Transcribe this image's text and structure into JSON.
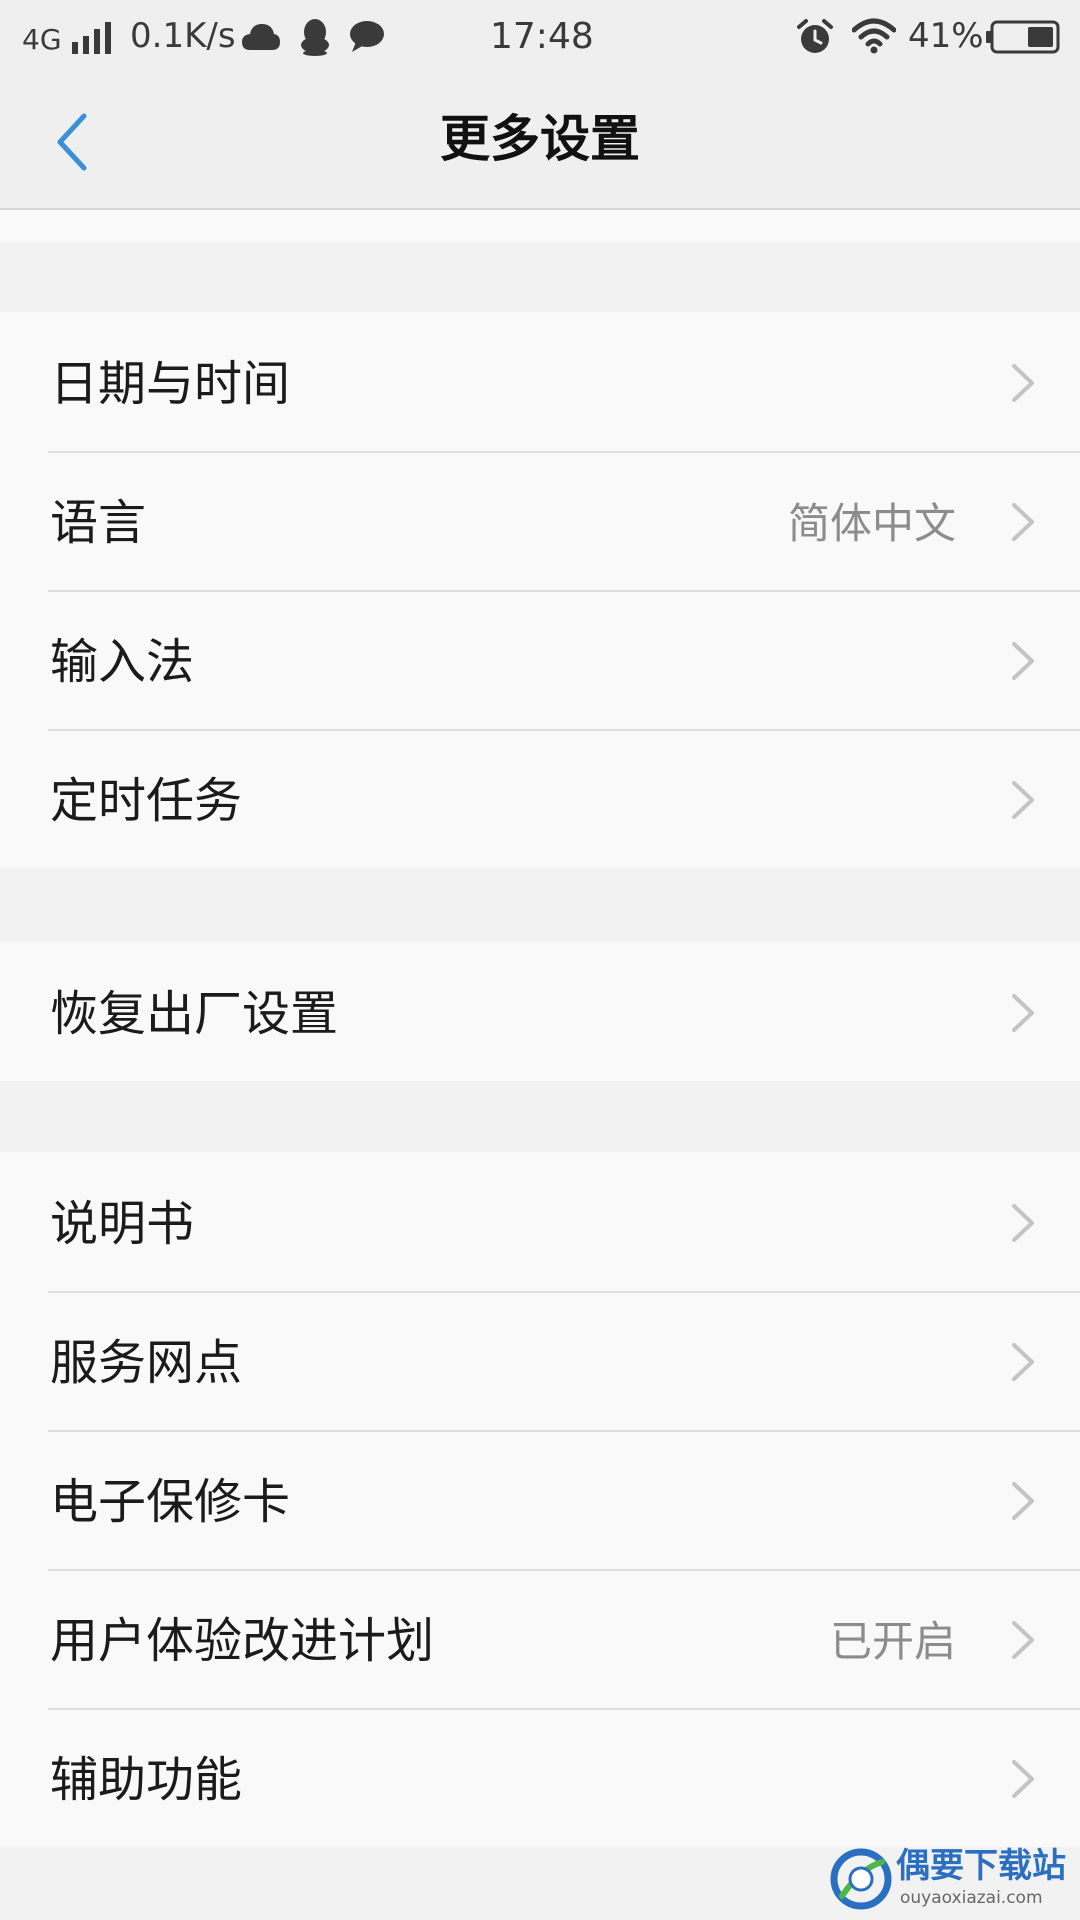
{
  "status_bar": {
    "network": "4G",
    "speed": "0.1K/s",
    "time": "17:48",
    "battery": "41%",
    "icons": [
      "signal-icon",
      "cloud-icon",
      "qq-icon",
      "chat-icon",
      "alarm-icon",
      "wifi-icon",
      "battery-icon"
    ]
  },
  "header": {
    "title": "更多设置",
    "back_icon": "chevron-left-icon"
  },
  "groups": [
    {
      "items": [
        {
          "label": "日期与时间",
          "value": ""
        },
        {
          "label": "语言",
          "value": "简体中文"
        },
        {
          "label": "输入法",
          "value": ""
        },
        {
          "label": "定时任务",
          "value": ""
        }
      ]
    },
    {
      "items": [
        {
          "label": "恢复出厂设置",
          "value": ""
        }
      ]
    },
    {
      "items": [
        {
          "label": "说明书",
          "value": ""
        },
        {
          "label": "服务网点",
          "value": ""
        },
        {
          "label": "电子保修卡",
          "value": ""
        },
        {
          "label": "用户体验改进计划",
          "value": "已开启"
        },
        {
          "label": "辅助功能",
          "value": ""
        }
      ]
    }
  ],
  "watermark": {
    "title": "偶要下载站",
    "url": "ouyaoxiazai.com"
  },
  "colors": {
    "accent": "#3b8fd9",
    "background": "#f2f2f2",
    "row_background": "#f9f9f9",
    "secondary_text": "#8c8c8c",
    "chevron": "#c4c4c4"
  }
}
